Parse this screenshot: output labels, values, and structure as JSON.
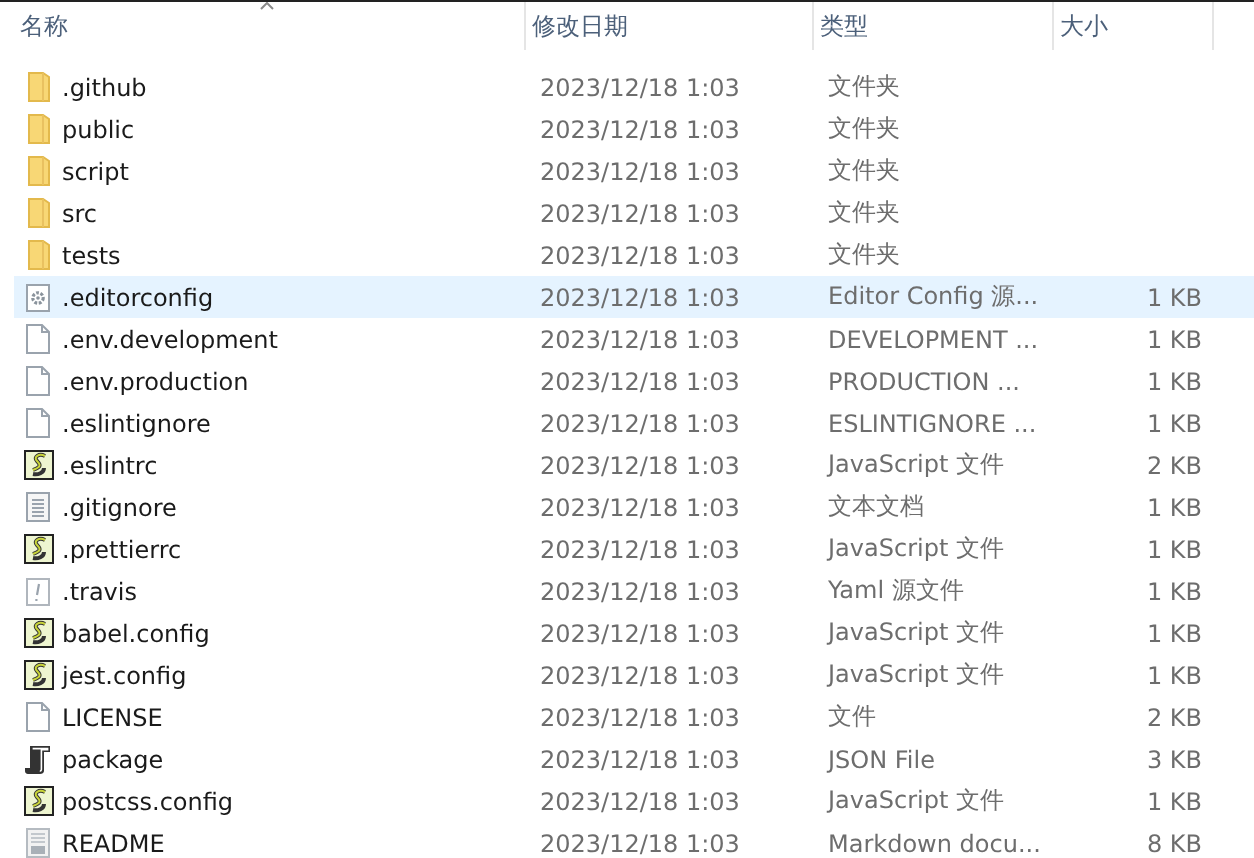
{
  "columns": [
    "名称",
    "修改日期",
    "类型",
    "大小"
  ],
  "files": [
    {
      "name": ".github",
      "date": "2023/12/18 1:03",
      "type": "文件夹",
      "kind": "folder",
      "selected": false
    },
    {
      "name": "public",
      "date": "2023/12/18 1:03",
      "type": "文件夹",
      "kind": "folder",
      "selected": false
    },
    {
      "name": "script",
      "date": "2023/12/18 1:03",
      "type": "文件夹",
      "kind": "folder",
      "selected": false
    },
    {
      "name": "src",
      "date": "2023/12/18 1:03",
      "type": "文件夹",
      "kind": "folder",
      "selected": false
    },
    {
      "name": "tests",
      "date": "2023/12/18 1:03",
      "type": "文件夹",
      "kind": "folder",
      "selected": false
    },
    {
      "name": ".editorconfig",
      "date": "2023/12/18 1:03",
      "type": "Editor Config 源...",
      "size": "1 KB",
      "kind": "gear",
      "selected": true
    },
    {
      "name": ".env.development",
      "date": "2023/12/18 1:03",
      "type": "DEVELOPMENT ...",
      "size": "1 KB",
      "kind": "blank",
      "selected": false
    },
    {
      "name": ".env.production",
      "date": "2023/12/18 1:03",
      "type": "PRODUCTION ...",
      "size": "1 KB",
      "kind": "blank",
      "selected": false
    },
    {
      "name": ".eslintignore",
      "date": "2023/12/18 1:03",
      "type": "ESLINTIGNORE ...",
      "size": "1 KB",
      "kind": "blank",
      "selected": false
    },
    {
      "name": ".eslintrc",
      "date": "2023/12/18 1:03",
      "type": "JavaScript 文件",
      "size": "2 KB",
      "kind": "script",
      "selected": false
    },
    {
      "name": ".gitignore",
      "date": "2023/12/18 1:03",
      "type": "文本文档",
      "size": "1 KB",
      "kind": "text",
      "selected": false
    },
    {
      "name": ".prettierrc",
      "date": "2023/12/18 1:03",
      "type": "JavaScript 文件",
      "size": "1 KB",
      "kind": "script",
      "selected": false
    },
    {
      "name": ".travis",
      "date": "2023/12/18 1:03",
      "type": "Yaml 源文件",
      "size": "1 KB",
      "kind": "warning",
      "selected": false
    },
    {
      "name": "babel.config",
      "date": "2023/12/18 1:03",
      "type": "JavaScript 文件",
      "size": "1 KB",
      "kind": "script",
      "selected": false
    },
    {
      "name": "jest.config",
      "date": "2023/12/18 1:03",
      "type": "JavaScript 文件",
      "size": "1 KB",
      "kind": "script",
      "selected": false
    },
    {
      "name": "LICENSE",
      "date": "2023/12/18 1:03",
      "type": "文件",
      "size": "2 KB",
      "kind": "blank",
      "selected": false
    },
    {
      "name": "package",
      "date": "2023/12/18 1:03",
      "type": "JSON File",
      "size": "3 KB",
      "kind": "scroll",
      "selected": false
    },
    {
      "name": "postcss.config",
      "date": "2023/12/18 1:03",
      "type": "JavaScript 文件",
      "size": "1 KB",
      "kind": "script",
      "selected": false
    },
    {
      "name": "README",
      "date": "2023/12/18 1:03",
      "type": "Markdown docu...",
      "size": "8 KB",
      "kind": "document",
      "selected": false
    }
  ]
}
